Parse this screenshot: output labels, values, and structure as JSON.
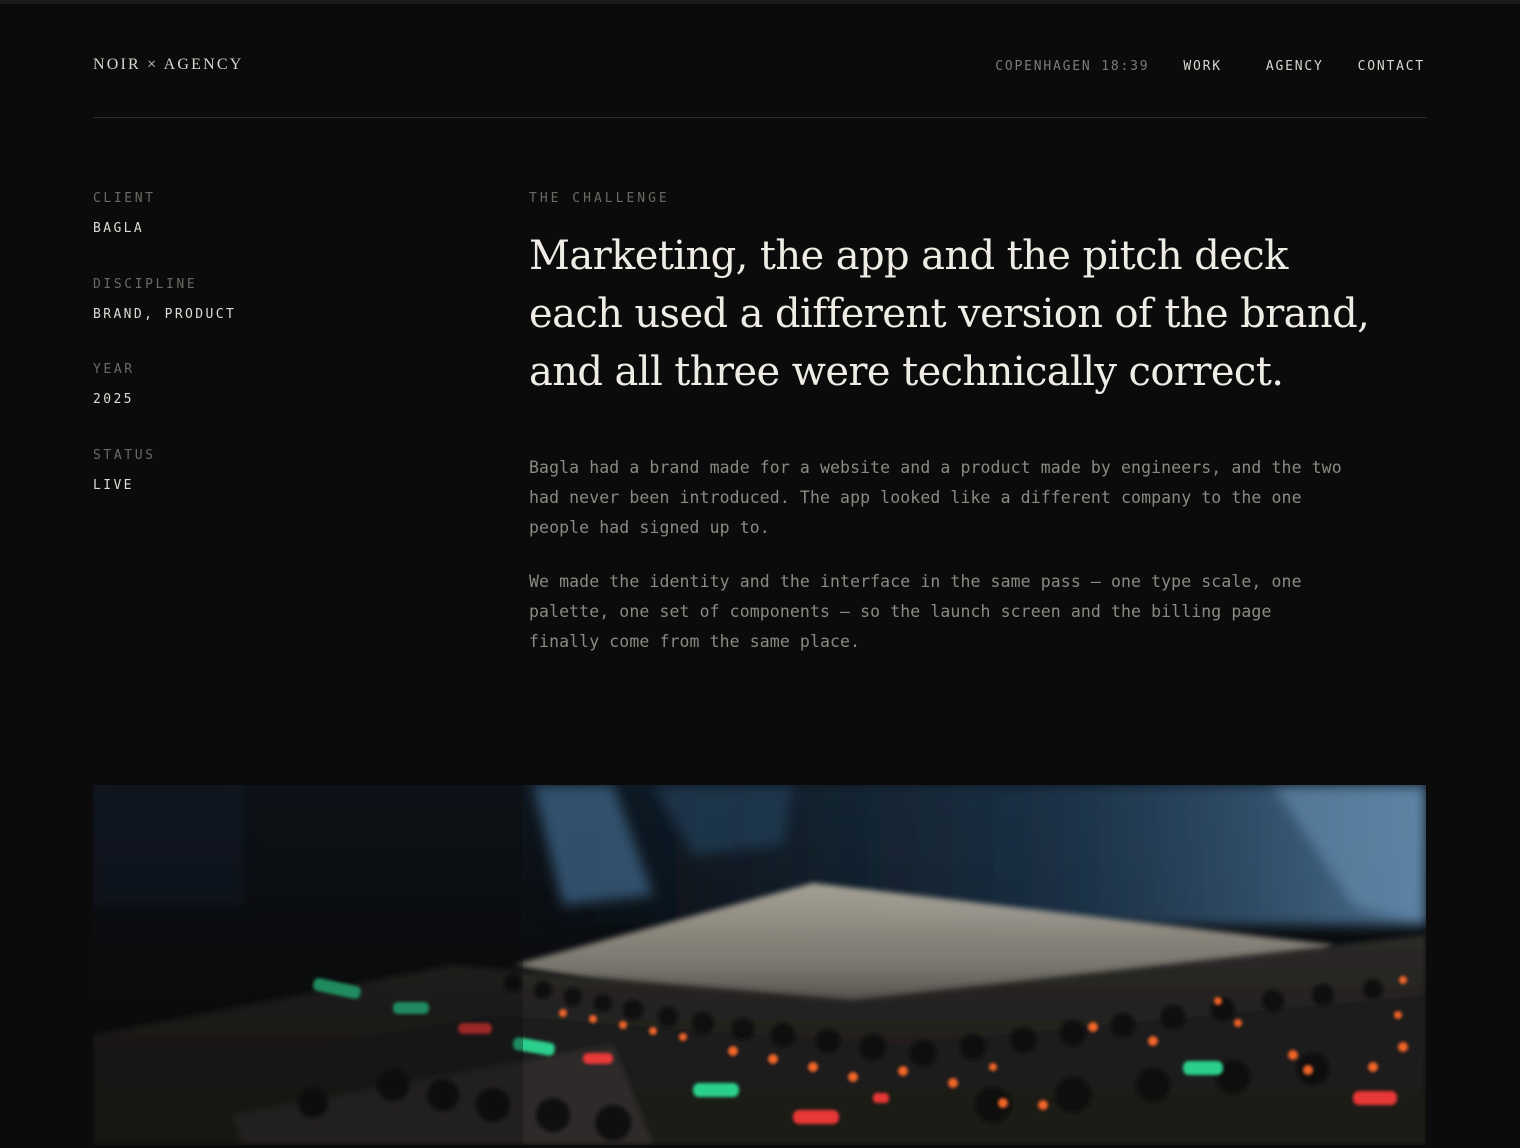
{
  "header": {
    "logo": "NOIR × AGENCY",
    "clock": "COPENHAGEN 18:39",
    "nav": [
      {
        "label": "WORK"
      },
      {
        "label": "AGENCY"
      },
      {
        "label": "CONTACT"
      }
    ]
  },
  "meta": [
    {
      "label": "CLIENT",
      "value": "BAGLA"
    },
    {
      "label": "DISCIPLINE",
      "value": "BRAND, PRODUCT"
    },
    {
      "label": "YEAR",
      "value": "2025"
    },
    {
      "label": "STATUS",
      "value": "LIVE"
    }
  ],
  "main": {
    "kicker": "THE CHALLENGE",
    "headline": "Marketing, the app and the pitch deck each used a different version of the brand, and all three were technically correct.",
    "paragraphs": [
      "Bagla had a brand made for a website and a product made by engineers, and the two had never been introduced. The app looked like a different company to the one people had signed up to.",
      "We made the identity and the interface in the same pass — one type scale, one palette, one set of components — so the launch screen and the billing page finally come from the same place."
    ]
  },
  "colors": {
    "background": "#0b0b0b",
    "text": "#efece5",
    "muted": "#6c6963",
    "led_green": "#2ee59a",
    "led_red": "#ff3b3b",
    "led_orange": "#ff6a2a"
  }
}
